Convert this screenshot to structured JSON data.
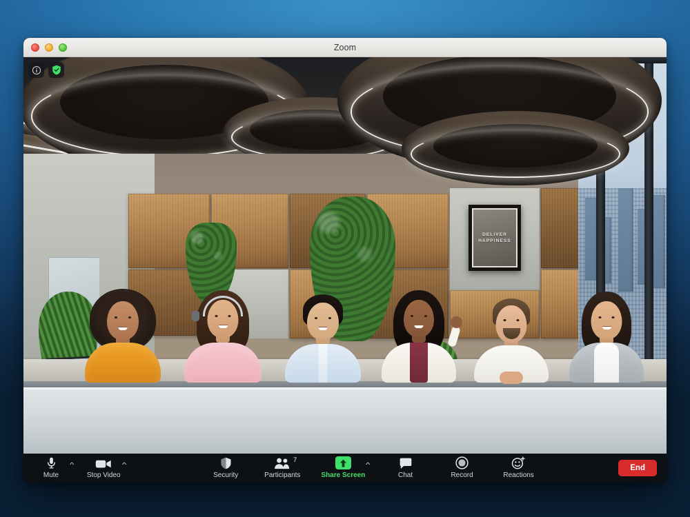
{
  "desktop": {
    "background_top": "#3b8fc7",
    "background_bottom": "#0b1f34"
  },
  "window": {
    "title": "Zoom",
    "controls": [
      {
        "name": "close",
        "color": "#e8483c"
      },
      {
        "name": "minimize",
        "color": "#e9a825"
      },
      {
        "name": "maximize",
        "color": "#4bc23a"
      }
    ]
  },
  "overlay": {
    "meeting_info_icon": "info-icon",
    "encryption_icon": "shield-check-icon",
    "encryption_color": "#3ee06a"
  },
  "stage": {
    "scene_description": "Video feed of a modern office conference room",
    "poster": {
      "line1": "DELIVER",
      "line2": "HAPPINESS"
    },
    "participants_in_frame": [
      {
        "id": 1,
        "hair": "#241a14",
        "skin": "#b9815c",
        "top_color": "#e8971f",
        "top": "orange sweater"
      },
      {
        "id": 2,
        "hair": "#3a2519",
        "skin": "#d8a883",
        "top_color": "#f0bcc4",
        "top": "pink sweater with headset"
      },
      {
        "id": 3,
        "hair": "#17120f",
        "skin": "#dbb28c",
        "top_color": "#cfe0ef",
        "top": "light blue shirt"
      },
      {
        "id": 4,
        "hair": "#120d0a",
        "skin": "#8a5a3d",
        "top_color": "#f4f1eb",
        "top": "white blazer over maroon top"
      },
      {
        "id": 5,
        "hair": "#5d4632",
        "skin": "#e0b092",
        "top_color": "#f2f0ea",
        "top": "white t-shirt"
      },
      {
        "id": 6,
        "hair": "#241a15",
        "skin": "#dcae8a",
        "top_color": "#b3b8bc",
        "top": "grey cardigan over white top"
      }
    ]
  },
  "toolbar": {
    "items": [
      {
        "id": "mute",
        "label": "Mute",
        "icon": "microphone-icon",
        "has_chevron": true,
        "highlight": false
      },
      {
        "id": "stop-video",
        "label": "Stop Video",
        "icon": "video-camera-icon",
        "has_chevron": true,
        "highlight": false
      },
      {
        "id": "security",
        "label": "Security",
        "icon": "shield-icon",
        "has_chevron": false,
        "highlight": false
      },
      {
        "id": "participants",
        "label": "Participants",
        "icon": "people-icon",
        "has_chevron": false,
        "highlight": false,
        "badge": "7"
      },
      {
        "id": "share-screen",
        "label": "Share Screen",
        "icon": "share-arrow-icon",
        "has_chevron": true,
        "highlight": true
      },
      {
        "id": "chat",
        "label": "Chat",
        "icon": "chat-bubble-icon",
        "has_chevron": false,
        "highlight": false
      },
      {
        "id": "record",
        "label": "Record",
        "icon": "record-circle-icon",
        "has_chevron": false,
        "highlight": false
      },
      {
        "id": "reactions",
        "label": "Reactions",
        "icon": "smiley-plus-icon",
        "has_chevron": false,
        "highlight": false
      }
    ],
    "end_button": {
      "label": "End",
      "color": "#d82b2b"
    },
    "share_color": "#3ee06a",
    "participant_count": "7"
  }
}
